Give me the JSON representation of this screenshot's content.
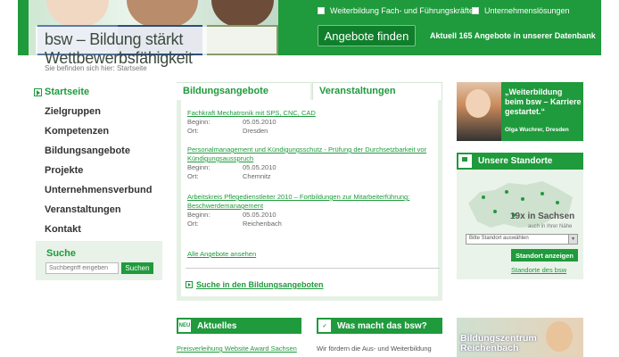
{
  "header": {
    "slogan": "bsw – Bildung stärkt Wettbewerbsfähigkeit",
    "checkbox1": "Weiterbildung Fach- und Führungskräfte",
    "checkbox2": "Unternehmenslösungen",
    "find_button": "Angebote finden",
    "count_text": "Aktuell 165 Angebote in unserer Datenbank"
  },
  "breadcrumb": "Sie befinden sich hier: Startseite",
  "nav": {
    "items": [
      "Startseite",
      "Zielgruppen",
      "Kompetenzen",
      "Bildungsangebote",
      "Projekte",
      "Unternehmensverbund",
      "Veranstaltungen",
      "Kontakt"
    ]
  },
  "search": {
    "title": "Suche",
    "placeholder": "Suchbegriff eingeben",
    "button": "Suchen"
  },
  "tabs": {
    "active": "Bildungsangebote",
    "inactive": "Veranstaltungen"
  },
  "offers": [
    {
      "title": "Fachkraft Mechatronik mit SPS, CNC, CAD",
      "begin_label": "Beginn:",
      "begin": "05.05.2010",
      "ort_label": "Ort:",
      "ort": "Dresden"
    },
    {
      "title": "Personalmanagement und Kündigungsschutz - Prüfung der Durchsetzbarkeit vor Kündigungsausspruch",
      "begin_label": "Beginn:",
      "begin": "05.05.2010",
      "ort_label": "Ort:",
      "ort": "Chemnitz"
    },
    {
      "title": "Arbeitskreis Pflegedienstleiter 2010 – Fortbildungen zur Mitarbeiterführung: Beschwerdemanagement",
      "begin_label": "Beginn:",
      "begin": "05.05.2010",
      "ort_label": "Ort:",
      "ort": "Reichenbach"
    }
  ],
  "all_offers_link": "Alle Angebote ansehen",
  "search_offers_link": "Suche in den Bildungsangeboten",
  "aktuelles": {
    "icon_text": "NEU",
    "title": "Aktuelles",
    "link": "Preisverleihung Website Award Sachsen"
  },
  "was_macht": {
    "title": "Was macht das bsw?",
    "text": "Wir fördern die Aus- und Weiterbildung"
  },
  "promo": {
    "quote": "„Weiterbildung beim bsw – Karriere gestartet.“",
    "name": "Olga Wuchrer, Dresden"
  },
  "standorte": {
    "title": "Unsere Standorte",
    "count": "19x in Sachsen",
    "sub": "auch in Ihrer Nähe",
    "select_placeholder": "Bitte Standort auswählen",
    "button": "Standort anzeigen",
    "link": "Standorte des bsw"
  },
  "zentrum": {
    "text_line1": "Bildungszentrum",
    "text_line2": "Reichenbach"
  },
  "colors": {
    "brand_green": "#1f9a3c",
    "panel_green": "#e6f1e6"
  }
}
